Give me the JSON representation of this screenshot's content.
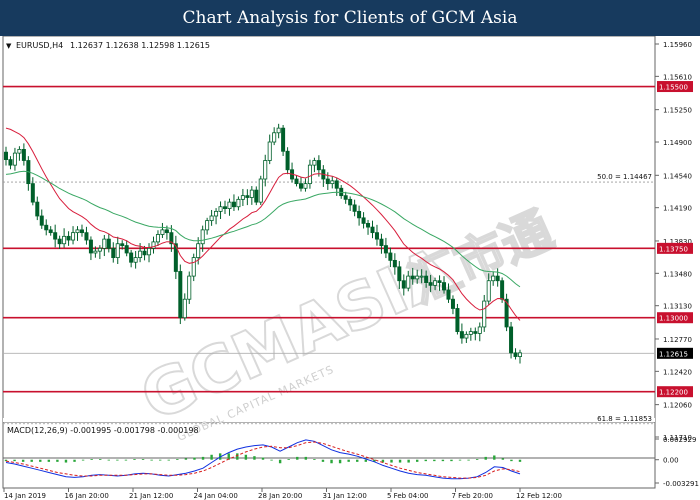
{
  "page": {
    "title": "Chart Analysis for Clients of GCM Asia"
  },
  "header": {
    "symbol_label": "EURUSD,H4",
    "ohlc": "1.12637 1.12638 1.12598 1.12615",
    "macd_label": "MACD(12,26,9) -0.001995 -0.001798 -0.000198"
  },
  "watermark": {
    "main": "GCMASIA",
    "chinese": "汇市通",
    "sub": "GLOBAL CAPITAL MARKETS"
  },
  "colors": {
    "candle": "#005f2a",
    "ma_fast": "#d81e3c",
    "ma_slow": "#3aa864",
    "level_line": "#c8102e",
    "level_label_bg": "#c8102e",
    "current_label_bg": "#000000",
    "macd_line": "#1030e0",
    "macd_signal": "#d81e1e",
    "macd_hist": "#2aa63a",
    "title_bg": "#173a5e"
  },
  "chart_data": [
    {
      "type": "candlestick",
      "symbol": "EURUSD",
      "timeframe": "H4",
      "ylim": [
        1.1171,
        1.1596
      ],
      "y_ticks": [
        1.1596,
        1.1561,
        1.1525,
        1.149,
        1.1454,
        1.1419,
        1.1383,
        1.1348,
        1.1313,
        1.1277,
        1.1242,
        1.1206,
        1.1171
      ],
      "y_tick_labels": [
        "1.15960",
        "1.15610",
        "1.15250",
        "1.14900",
        "1.14540",
        "1.14190",
        "1.13830",
        "1.13480",
        "1.13130",
        "1.12770",
        "1.12420",
        "1.12060",
        "1.11710"
      ],
      "x_tick_labels": [
        "14 Jan 2019",
        "16 Jan 20:00",
        "21 Jan 12:00",
        "24 Jan 04:00",
        "28 Jan 20:00",
        "31 Jan 12:00",
        "5 Feb 04:00",
        "7 Feb 20:00",
        "12 Feb 12:00"
      ],
      "current_price": 1.12615,
      "current_price_label": "1.12615",
      "horizontal_levels": [
        {
          "value": 1.155,
          "label": "1.15500"
        },
        {
          "value": 1.1375,
          "label": "1.13750"
        },
        {
          "value": 1.13,
          "label": "1.13000"
        },
        {
          "value": 1.122,
          "label": "1.12200"
        }
      ],
      "fibonacci": [
        {
          "value": 1.14467,
          "label": "50.0 = 1.14467"
        },
        {
          "value": 1.11853,
          "label": "61.8 = 1.11853"
        }
      ],
      "close": [
        1.1471,
        1.1465,
        1.1478,
        1.1482,
        1.147,
        1.1445,
        1.1425,
        1.141,
        1.14,
        1.1395,
        1.1392,
        1.1385,
        1.138,
        1.1388,
        1.1384,
        1.1392,
        1.1395,
        1.1392,
        1.1384,
        1.137,
        1.1372,
        1.1375,
        1.1385,
        1.1375,
        1.1365,
        1.138,
        1.1378,
        1.137,
        1.136,
        1.1365,
        1.1372,
        1.1368,
        1.1375,
        1.1382,
        1.139,
        1.1395,
        1.1392,
        1.138,
        1.135,
        1.13,
        1.132,
        1.1345,
        1.1365,
        1.138,
        1.1395,
        1.1405,
        1.141,
        1.1415,
        1.142,
        1.1418,
        1.1425,
        1.142,
        1.1428,
        1.1432,
        1.143,
        1.1438,
        1.1425,
        1.145,
        1.147,
        1.149,
        1.15,
        1.1505,
        1.148,
        1.146,
        1.145,
        1.1445,
        1.144,
        1.1445,
        1.1465,
        1.147,
        1.146,
        1.145,
        1.1445,
        1.1448,
        1.144,
        1.1432,
        1.1428,
        1.1422,
        1.1415,
        1.1408,
        1.1402,
        1.1398,
        1.1392,
        1.1385,
        1.1378,
        1.137,
        1.1362,
        1.1355,
        1.134,
        1.1332,
        1.1345,
        1.1342,
        1.1345,
        1.1345,
        1.1338,
        1.1335,
        1.134,
        1.1338,
        1.133,
        1.132,
        1.131,
        1.1285,
        1.1278,
        1.1282,
        1.1285,
        1.1283,
        1.129,
        1.1318,
        1.134,
        1.1345,
        1.134,
        1.132,
        1.129,
        1.1262,
        1.1258,
        1.1262
      ],
      "series": [
        {
          "name": "",
          "kind": "moving-average-fast"
        },
        {
          "name": "",
          "kind": "moving-average-slow"
        }
      ]
    },
    {
      "type": "line",
      "title": "MACD(12,26,9)",
      "ylim": [
        -0.003291,
        0.002929
      ],
      "y_tick_labels": [
        "0.002929",
        "0.00",
        "-0.003291"
      ],
      "macd": [
        -0.0004,
        -0.0006,
        -0.0009,
        -0.0012,
        -0.0015,
        -0.0018,
        -0.0021,
        -0.0024,
        -0.0025,
        -0.0024,
        -0.0022,
        -0.0021,
        -0.0022,
        -0.0023,
        -0.0022,
        -0.002,
        -0.0019,
        -0.002,
        -0.0022,
        -0.0023,
        -0.0021,
        -0.0019,
        -0.0016,
        -0.0012,
        -0.0004,
        0.0004,
        0.001,
        0.0015,
        0.0018,
        0.002,
        0.0021,
        0.0018,
        0.0012,
        0.0018,
        0.0024,
        0.0028,
        0.0026,
        0.002,
        0.0014,
        0.001,
        0.0008,
        0.0005,
        0.0001,
        -0.0003,
        -0.0008,
        -0.0012,
        -0.0016,
        -0.0019,
        -0.0021,
        -0.0022,
        -0.0024,
        -0.0026,
        -0.0027,
        -0.0027,
        -0.0026,
        -0.0024,
        -0.0018,
        -0.001,
        -0.0011,
        -0.0016,
        -0.002
      ],
      "signal": [
        -0.0002,
        -0.0004,
        -0.0006,
        -0.0009,
        -0.0012,
        -0.0015,
        -0.0018,
        -0.002,
        -0.0022,
        -0.0023,
        -0.0023,
        -0.0022,
        -0.0022,
        -0.0022,
        -0.0022,
        -0.0021,
        -0.002,
        -0.002,
        -0.0021,
        -0.0022,
        -0.0022,
        -0.0021,
        -0.0019,
        -0.0016,
        -0.0011,
        -0.0005,
        0.0001,
        0.0006,
        0.0011,
        0.0015,
        0.0018,
        0.0019,
        0.0017,
        0.0017,
        0.002,
        0.0024,
        0.0025,
        0.0023,
        0.0019,
        0.0015,
        0.0011,
        0.0008,
        0.0004,
        0.0,
        -0.0004,
        -0.0008,
        -0.0012,
        -0.0015,
        -0.0018,
        -0.002,
        -0.0022,
        -0.0024,
        -0.0025,
        -0.0026,
        -0.0026,
        -0.0025,
        -0.0022,
        -0.0016,
        -0.0013,
        -0.0014,
        -0.0017
      ]
    }
  ]
}
